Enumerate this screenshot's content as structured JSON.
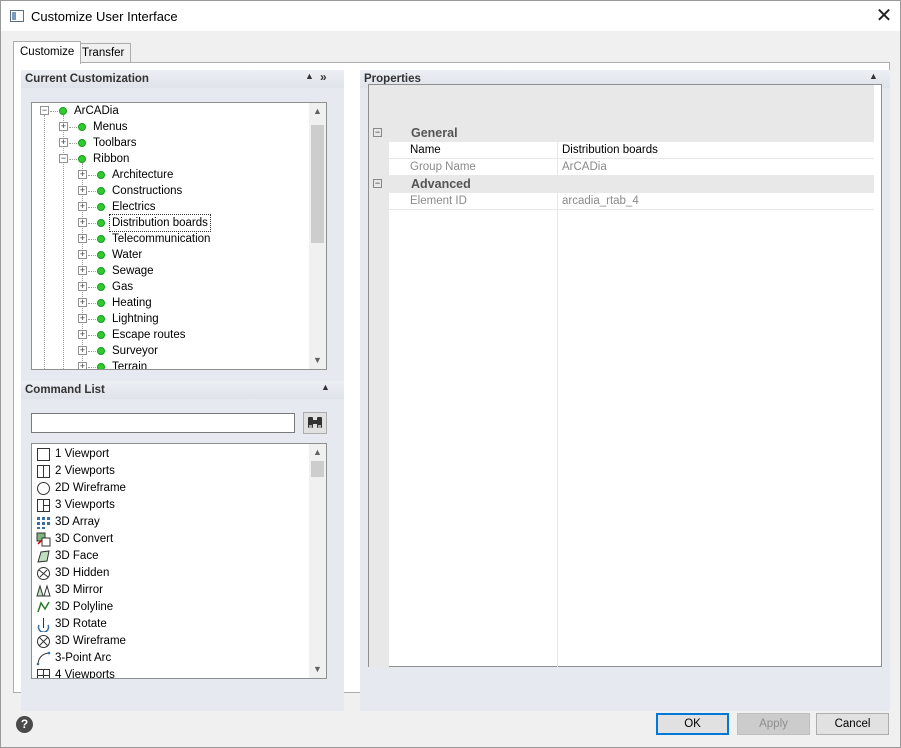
{
  "window": {
    "title": "Customize User Interface",
    "close_glyph": "✕"
  },
  "tabs": [
    {
      "label": "Customize"
    },
    {
      "label": "Transfer"
    }
  ],
  "current_customization": {
    "header": "Current Customization",
    "collapse_glyph": "▲",
    "expand_glyph": "»",
    "tree": {
      "root": "ArCADia",
      "level1": [
        "Menus",
        "Toolbars",
        "Ribbon"
      ],
      "ribbon_children": [
        "Architecture",
        "Constructions",
        "Electrics",
        "Distribution boards",
        "Telecommunication",
        "Water",
        "Sewage",
        "Gas",
        "Heating",
        "Lightning",
        "Escape routes",
        "Surveyor",
        "Terrain"
      ],
      "selected": "Distribution boards"
    }
  },
  "command_list": {
    "header": "Command List",
    "collapse_glyph": "▲",
    "search_value": "",
    "find_icon": "binoculars-icon",
    "commands": [
      {
        "label": "1 Viewport",
        "icon": "viewport-1-icon"
      },
      {
        "label": "2 Viewports",
        "icon": "viewport-2-icon"
      },
      {
        "label": "2D Wireframe",
        "icon": "wireframe-2d-icon"
      },
      {
        "label": "3 Viewports",
        "icon": "viewport-3-icon"
      },
      {
        "label": "3D Array",
        "icon": "array-3d-icon"
      },
      {
        "label": "3D Convert",
        "icon": "convert-3d-icon"
      },
      {
        "label": "3D Face",
        "icon": "face-3d-icon"
      },
      {
        "label": "3D Hidden",
        "icon": "hidden-3d-icon"
      },
      {
        "label": "3D Mirror",
        "icon": "mirror-3d-icon"
      },
      {
        "label": "3D Polyline",
        "icon": "polyline-3d-icon"
      },
      {
        "label": "3D Rotate",
        "icon": "rotate-3d-icon"
      },
      {
        "label": "3D Wireframe",
        "icon": "wireframe-3d-icon"
      },
      {
        "label": "3-Point Arc",
        "icon": "arc-3point-icon"
      },
      {
        "label": "4 Viewports",
        "icon": "viewport-4-icon"
      }
    ]
  },
  "properties": {
    "header": "Properties",
    "collapse_glyph": "▲",
    "categories": [
      {
        "name": "General",
        "rows": [
          {
            "key": "Name",
            "value": "Distribution boards",
            "readonly": false
          },
          {
            "key": "Group Name",
            "value": "ArCADia",
            "readonly": true
          }
        ]
      },
      {
        "name": "Advanced",
        "rows": [
          {
            "key": "Element ID",
            "value": "arcadia_rtab_4",
            "readonly": true
          }
        ]
      }
    ]
  },
  "footer": {
    "help_glyph": "?",
    "ok_label": "OK",
    "apply_label": "Apply",
    "cancel_label": "Cancel"
  },
  "colors": {
    "accent": "#0078d7",
    "tree_dot": "#2ecc2e"
  }
}
